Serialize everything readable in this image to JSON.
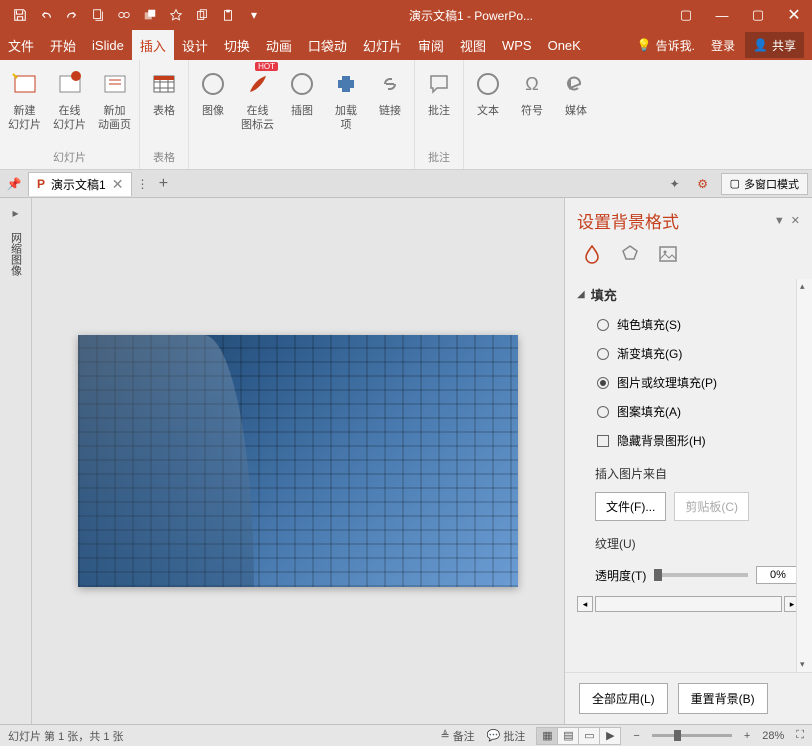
{
  "title": "演示文稿1 - PowerPo...",
  "menu": {
    "file": "文件",
    "home": "开始",
    "islide": "iSlide",
    "insert": "插入",
    "design": "设计",
    "transition": "切换",
    "animation": "动画",
    "pocket": "口袋动",
    "slideshow": "幻灯片",
    "review": "审阅",
    "view": "视图",
    "wps": "WPS",
    "onek": "OneK",
    "tellme": "告诉我.",
    "login": "登录",
    "share": "共享"
  },
  "ribbon": {
    "new_slide": "新建\n幻灯片",
    "online_slide": "在线\n幻灯片",
    "new_anim": "新加\n动画页",
    "table": "表格",
    "image": "图像",
    "icon_cloud": "在线\n图标云",
    "illustration": "插图",
    "addin": "加载\n项",
    "link": "链接",
    "comment": "批注",
    "text": "文本",
    "symbol": "符号",
    "media": "媒体",
    "group_slides": "幻灯片",
    "group_table": "表格",
    "group_comment": "批注",
    "hot": "HOT"
  },
  "tabstrip": {
    "doc_name": "演示文稿1",
    "multiwin": "多窗口模式"
  },
  "rail": {
    "thumbnail": "网缩图像"
  },
  "panel": {
    "title": "设置背景格式",
    "section_fill": "填充",
    "solid": "纯色填充(S)",
    "gradient": "渐变填充(G)",
    "picture": "图片或纹理填充(P)",
    "pattern": "图案填充(A)",
    "hide_bg": "隐藏背景图形(H)",
    "insert_from": "插入图片来自",
    "file_btn": "文件(F)...",
    "clipboard_btn": "剪贴板(C)",
    "texture": "纹理(U)",
    "transparency": "透明度(T)",
    "transparency_val": "0%",
    "apply_all": "全部应用(L)",
    "reset": "重置背景(B)"
  },
  "status": {
    "slide_info": "幻灯片 第 1 张，共 1 张",
    "notes": "备注",
    "comments": "批注",
    "zoom": "28%"
  }
}
